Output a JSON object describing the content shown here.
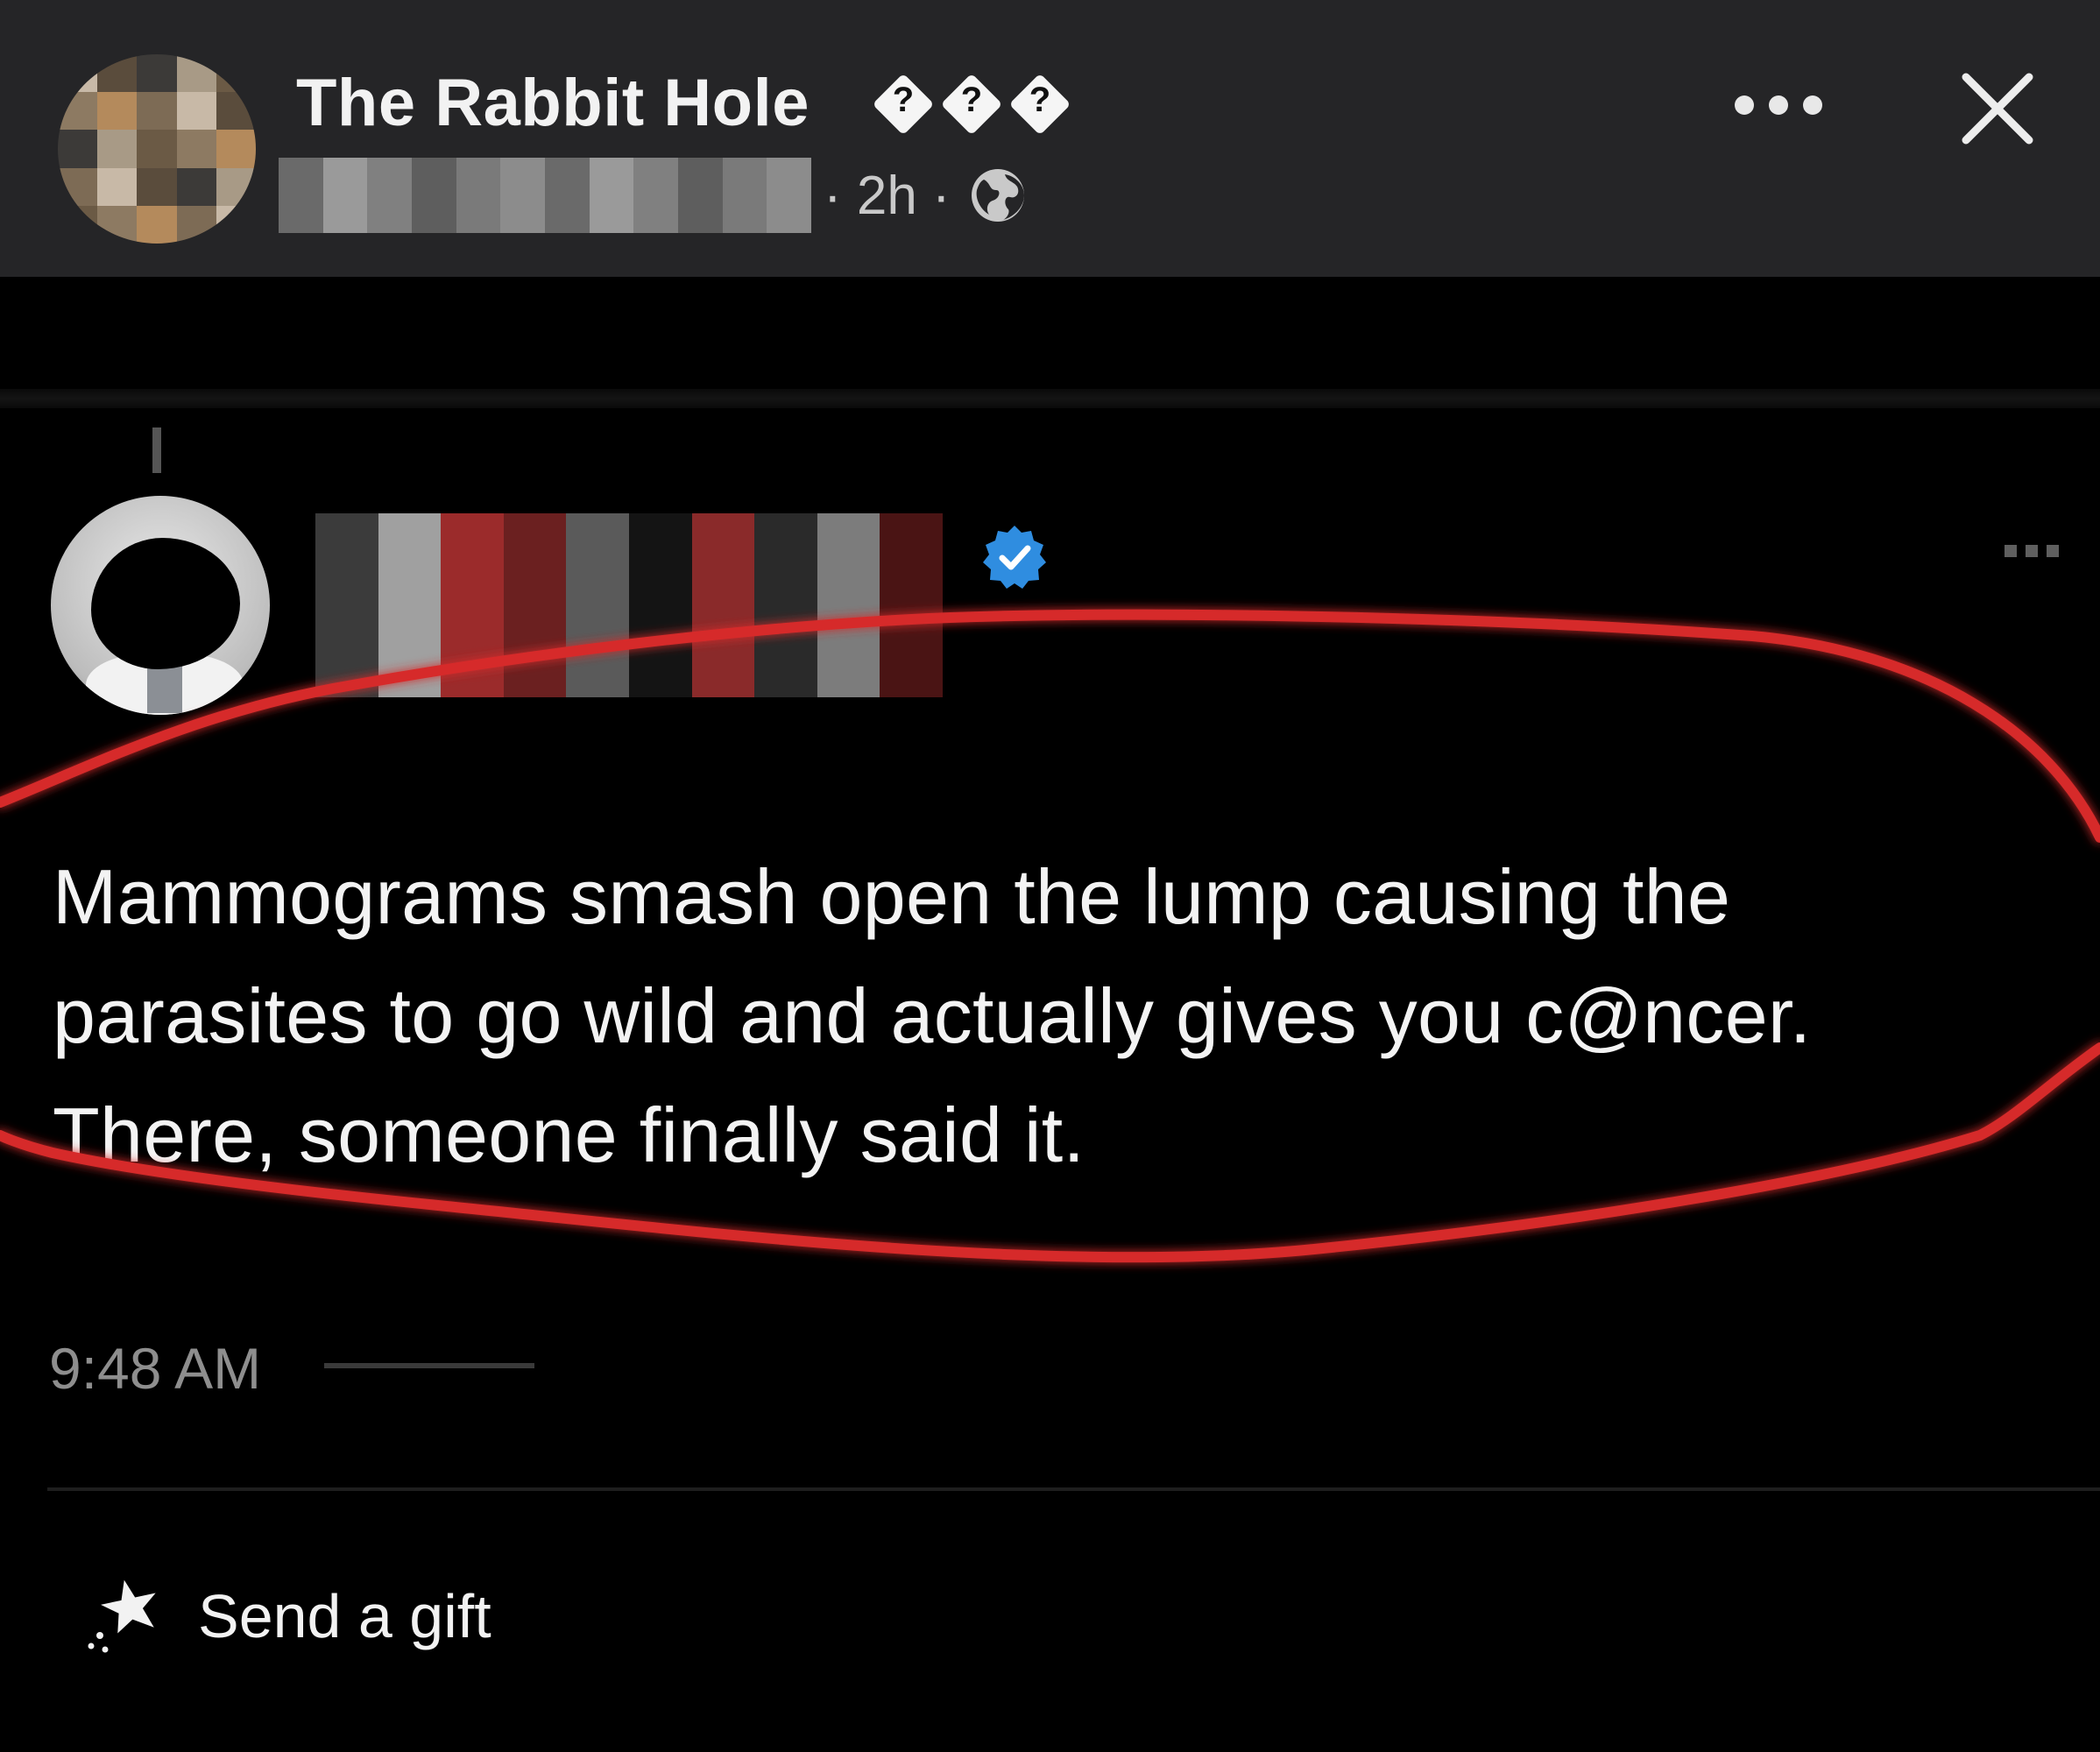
{
  "header": {
    "page_name": "The Rabbit Hole",
    "badge_glyph": "?",
    "meta": "· 2h ·",
    "icons": [
      "globe-icon",
      "more-icon",
      "close-icon"
    ]
  },
  "tweet": {
    "lines": [
      "Mammograms smash open the lump causing the",
      "parasites to go wild and actually gives you c@ncer.",
      "There, someone finally said it."
    ],
    "time": "9:48 AM",
    "icons": [
      "verified-icon",
      "more-icon"
    ]
  },
  "annotation_color": "#d62a2a",
  "actions": {
    "gift_label": "Send a gift",
    "gift_icon": "gift-sparkle-icon"
  },
  "colors": {
    "header_bg": "#252527",
    "body_bg": "#000000",
    "text_primary": "#f3f3f3",
    "text_secondary": "#c9c9c9",
    "verified_blue": "#1d9bf0"
  }
}
